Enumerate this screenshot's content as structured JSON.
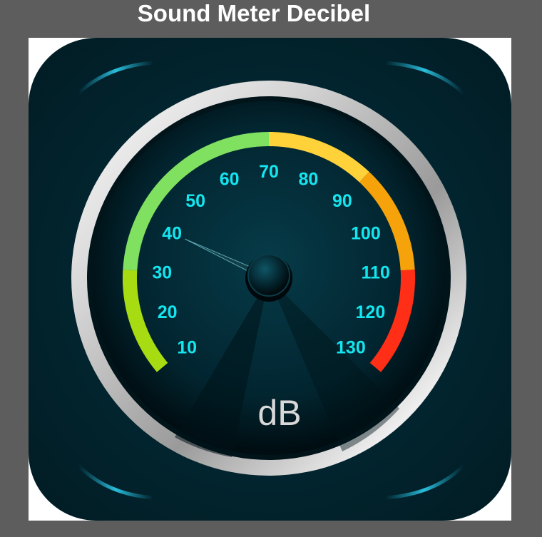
{
  "header": {
    "title": "Sound Meter Decibel"
  },
  "gauge": {
    "unit": "dB",
    "needle_value": 40,
    "scale_min": 10,
    "scale_max": 130,
    "ticks": [
      {
        "value": 10,
        "label": "10"
      },
      {
        "value": 20,
        "label": "20"
      },
      {
        "value": 30,
        "label": "30"
      },
      {
        "value": 40,
        "label": "40"
      },
      {
        "value": 50,
        "label": "50"
      },
      {
        "value": 60,
        "label": "60"
      },
      {
        "value": 70,
        "label": "70"
      },
      {
        "value": 80,
        "label": "80"
      },
      {
        "value": 90,
        "label": "90"
      },
      {
        "value": 100,
        "label": "100"
      },
      {
        "value": 110,
        "label": "110"
      },
      {
        "value": 120,
        "label": "120"
      },
      {
        "value": 130,
        "label": "130"
      }
    ],
    "zones": [
      {
        "from": 10,
        "to": 30,
        "color": "#a8dc12"
      },
      {
        "from": 30,
        "to": 70,
        "color": "#80e060"
      },
      {
        "from": 70,
        "to": 90,
        "color": "#ffd23a"
      },
      {
        "from": 90,
        "to": 110,
        "color": "#f6a20a"
      },
      {
        "from": 110,
        "to": 130,
        "color": "#ff2e16"
      }
    ],
    "colors": {
      "label": "#14e6f0",
      "unit_text": "#d8d8d8",
      "bezel": "#cfcfcf",
      "face": "#02222c",
      "background": "#022a35"
    }
  }
}
